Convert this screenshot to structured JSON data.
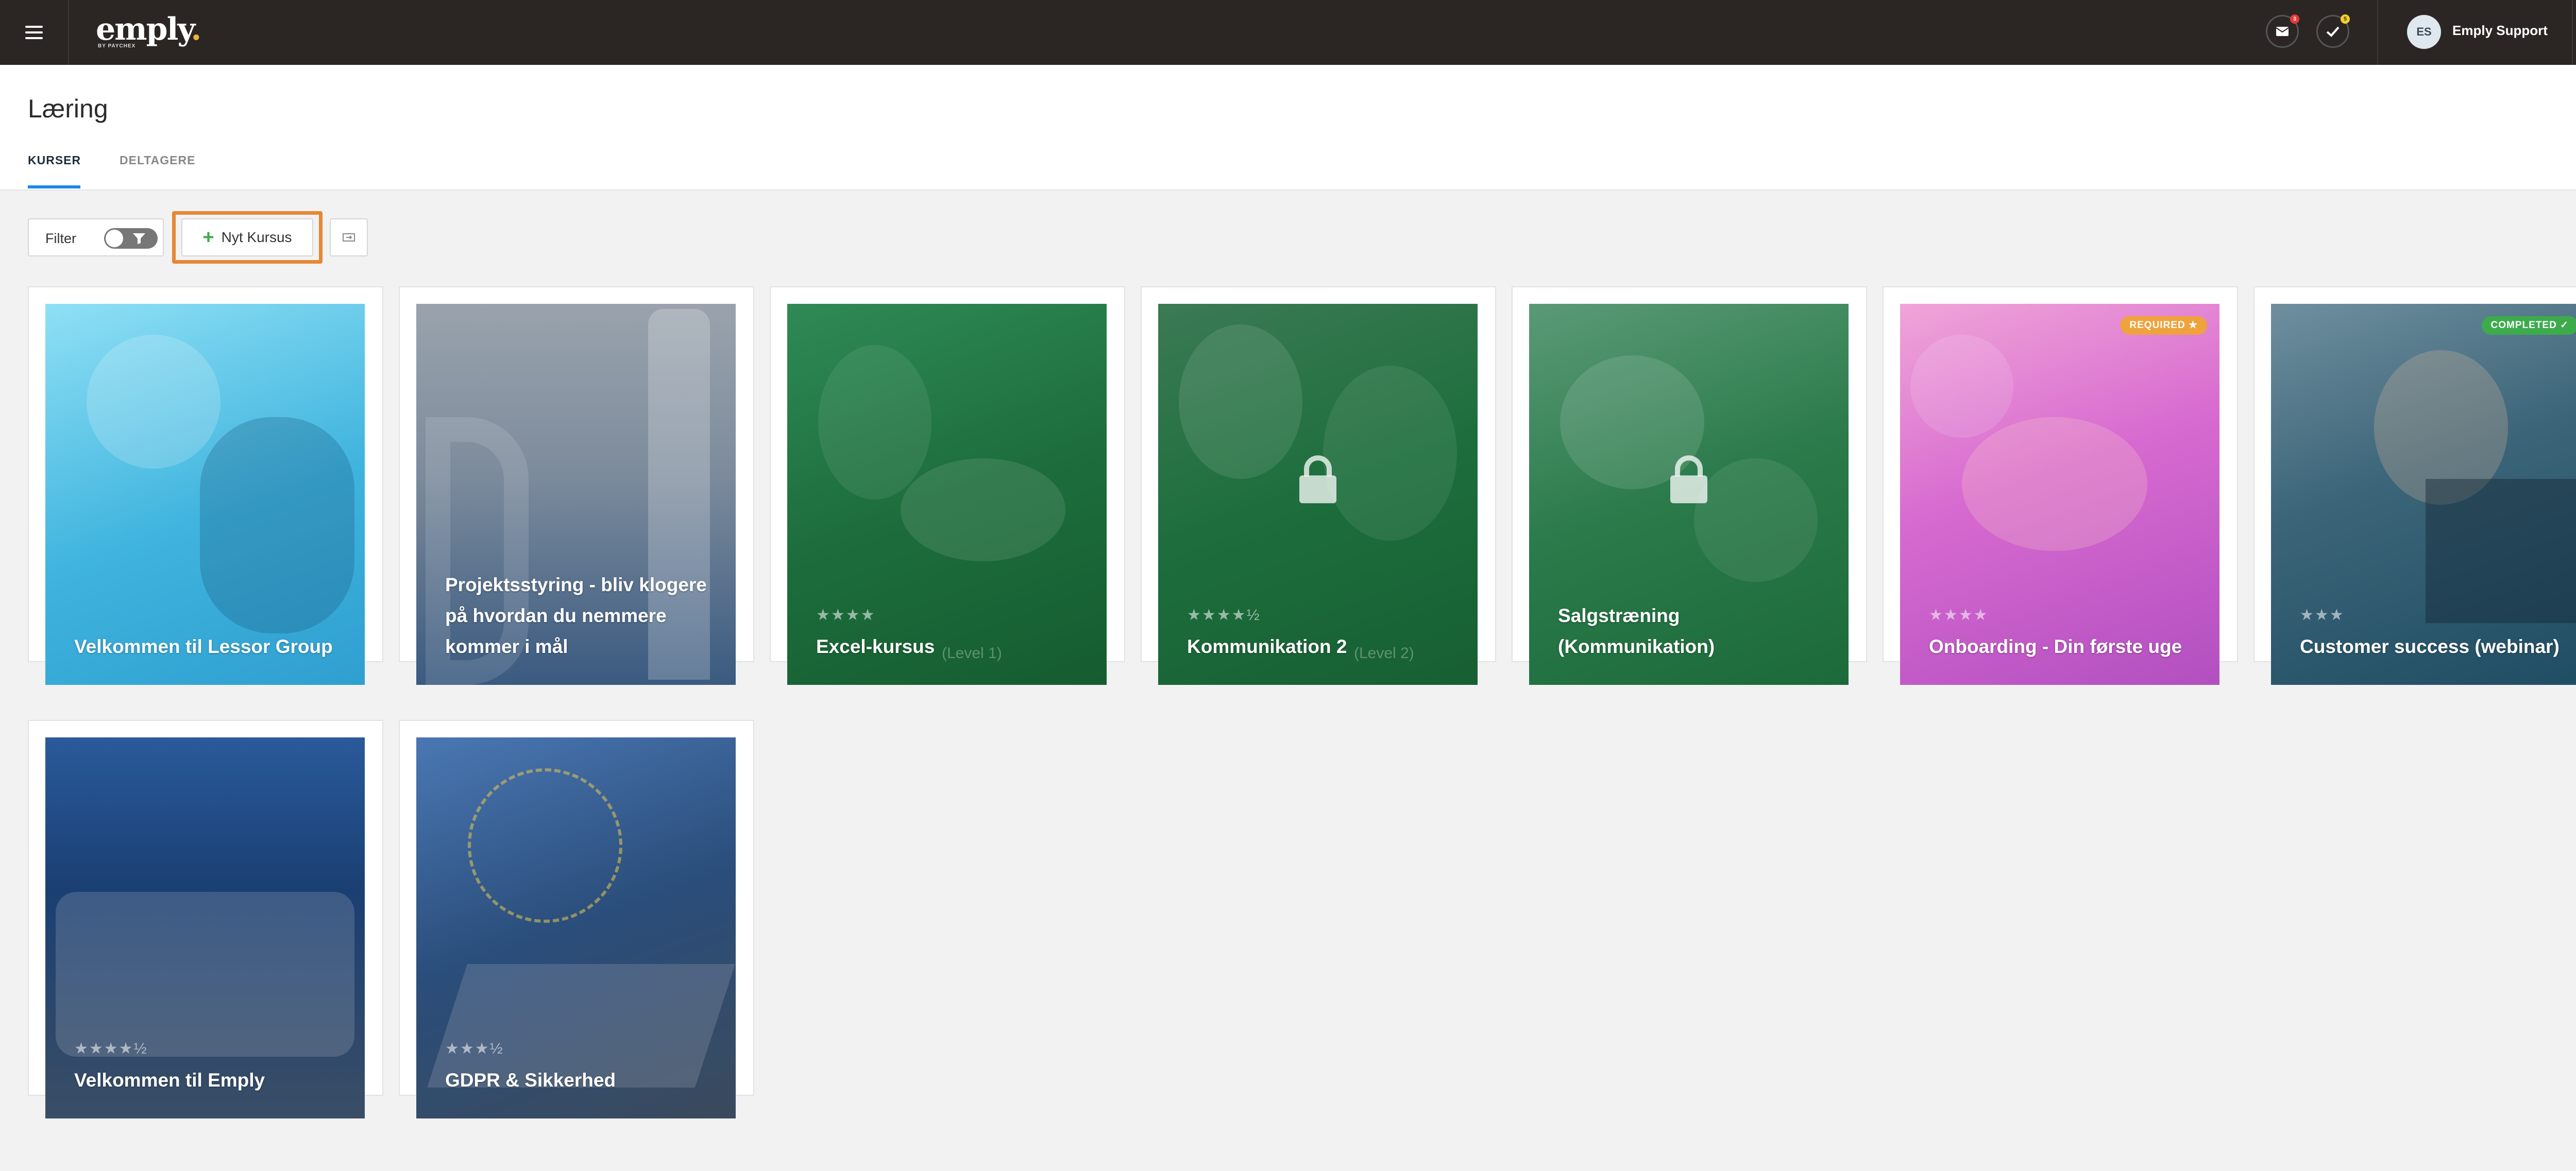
{
  "topbar": {
    "logo_text": "emply",
    "logo_dot": ".",
    "logo_sub": "BY PAYCHEX",
    "mail_badge": "3",
    "tasks_badge": "5",
    "avatar_initials": "ES",
    "user_name": "Emply Support"
  },
  "page": {
    "title": "Læring",
    "tabs": [
      {
        "label": "KURSER",
        "active": true
      },
      {
        "label": "DELTAGERE",
        "active": false
      }
    ]
  },
  "toolbar": {
    "filter_label": "Filter",
    "new_course_label": "Nyt Kursus"
  },
  "courses": [
    {
      "title": "Velkommen til Lessor Group",
      "stars": "",
      "subtitle": "",
      "locked": false,
      "badge": "",
      "color": "#5cc4e6"
    },
    {
      "title": "Projektsstyring - bliv klogere på hvordan du nemmere kommer i mål",
      "stars": "",
      "subtitle": "",
      "locked": false,
      "badge": "",
      "color": "#5b6f86"
    },
    {
      "title": "Excel-kursus",
      "stars": "★★★★",
      "subtitle": "(Level 1)",
      "locked": false,
      "badge": "",
      "color": "#1d6e3c"
    },
    {
      "title": "Kommunikation 2",
      "stars": "★★★★½",
      "subtitle": "(Level 2)",
      "locked": true,
      "badge": "",
      "color": "#1d6e3c"
    },
    {
      "title": "Salgstræning (Kommunikation)",
      "stars": "",
      "subtitle": "",
      "locked": true,
      "badge": "",
      "color": "#2a7a4a"
    },
    {
      "title": "Onboarding - Din første uge",
      "stars": "★★★★",
      "subtitle": "",
      "locked": false,
      "badge": "REQUIRED ★",
      "color": "#c45bc8"
    },
    {
      "title": "Customer success (webinar)",
      "stars": "★★★",
      "subtitle": "",
      "locked": false,
      "badge": "COMPLETED ✓",
      "color": "#1f4d63"
    },
    {
      "title": "Velkommen til Emply",
      "stars": "★★★★½",
      "subtitle": "",
      "locked": false,
      "badge": "",
      "color": "#1a3f73"
    },
    {
      "title": "GDPR & Sikkerhed",
      "stars": "★★★½",
      "subtitle": "",
      "locked": false,
      "badge": "",
      "color": "#2a4d7a"
    }
  ],
  "colors": {
    "accent_tab": "#1e88e5",
    "highlight": "#e58835",
    "required_badge": "#f0a23c",
    "completed_badge": "#3cab4c"
  }
}
